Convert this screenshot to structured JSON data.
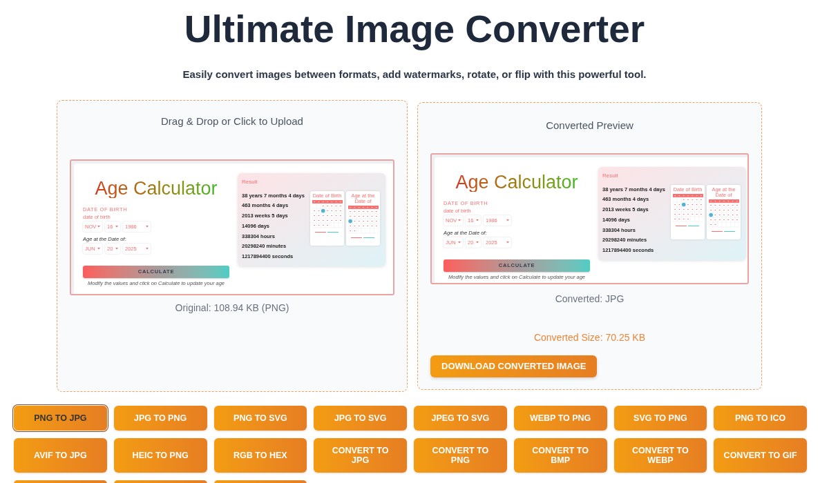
{
  "header": {
    "title": "Ultimate Image Converter",
    "subtitle": "Easily convert images between formats, add watermarks, rotate, or flip with this powerful tool."
  },
  "upload_panel": {
    "prompt": "Drag & Drop or Click to Upload",
    "preview": {
      "title": "Age Calculator",
      "section_label": "DATE OF BIRTH",
      "birth_label": "date of birth",
      "birth_fields": [
        "NOV",
        "16",
        "1986"
      ],
      "target_label": "Age at the Date of:",
      "target_fields": [
        "JUN",
        "20",
        "2025"
      ],
      "calculate_button": "CALCULATE",
      "hint": "Modify the values and click on Calculate to update your age",
      "result": {
        "heading": "Result",
        "lines": [
          "38 years 7 months 4 days",
          "463 months 4 days",
          "2013 weeks 5 days",
          "14096 days",
          "338304 hours",
          "20298240 minutes",
          "1217894400 seconds"
        ]
      },
      "calendars": [
        {
          "title": "Date of Birth"
        },
        {
          "title": "Age at the Date of"
        }
      ]
    },
    "original_info": "Original: 108.94 KB (PNG)"
  },
  "converted_panel": {
    "heading": "Converted Preview",
    "preview": {
      "title": "Age Calculator",
      "section_label": "DATE OF BIRTH",
      "birth_label": "date of birth",
      "birth_fields": [
        "NOV",
        "16",
        "1986"
      ],
      "target_label": "Age at the Date of:",
      "target_fields": [
        "JUN",
        "20",
        "2025"
      ],
      "calculate_button": "CALCULATE",
      "hint": "Modify the values and click on Calculate to update your age",
      "result": {
        "heading": "Result",
        "lines": [
          "38 years 7 months 4 days",
          "463 months 4 days",
          "2013 weeks 5 days",
          "14096 days",
          "338304 hours",
          "20298240 minutes",
          "1217894400 seconds"
        ]
      },
      "calendars": [
        {
          "title": "Date of Birth"
        },
        {
          "title": "Age at the Date of"
        }
      ]
    },
    "format_info": "Converted: JPG",
    "size_info": "Converted Size: 70.25 KB",
    "download_button": "DOWNLOAD CONVERTED IMAGE"
  },
  "conversion_buttons": [
    {
      "label": "PNG TO JPG",
      "selected": true
    },
    {
      "label": "JPG TO PNG",
      "selected": false
    },
    {
      "label": "PNG TO SVG",
      "selected": false
    },
    {
      "label": "JPG TO SVG",
      "selected": false
    },
    {
      "label": "JPEG TO SVG",
      "selected": false
    },
    {
      "label": "WEBP TO PNG",
      "selected": false
    },
    {
      "label": "SVG TO PNG",
      "selected": false
    },
    {
      "label": "PNG TO ICO",
      "selected": false
    },
    {
      "label": "AVIF TO JPG",
      "selected": false
    },
    {
      "label": "HEIC TO PNG",
      "selected": false
    },
    {
      "label": "RGB TO HEX",
      "selected": false
    },
    {
      "label": "CONVERT TO JPG",
      "selected": false
    },
    {
      "label": "CONVERT TO PNG",
      "selected": false
    },
    {
      "label": "CONVERT TO BMP",
      "selected": false
    },
    {
      "label": "CONVERT TO WEBP",
      "selected": false
    },
    {
      "label": "CONVERT TO GIF",
      "selected": false
    },
    {
      "selected": false
    },
    {
      "selected": false
    },
    {
      "selected": false
    }
  ]
}
